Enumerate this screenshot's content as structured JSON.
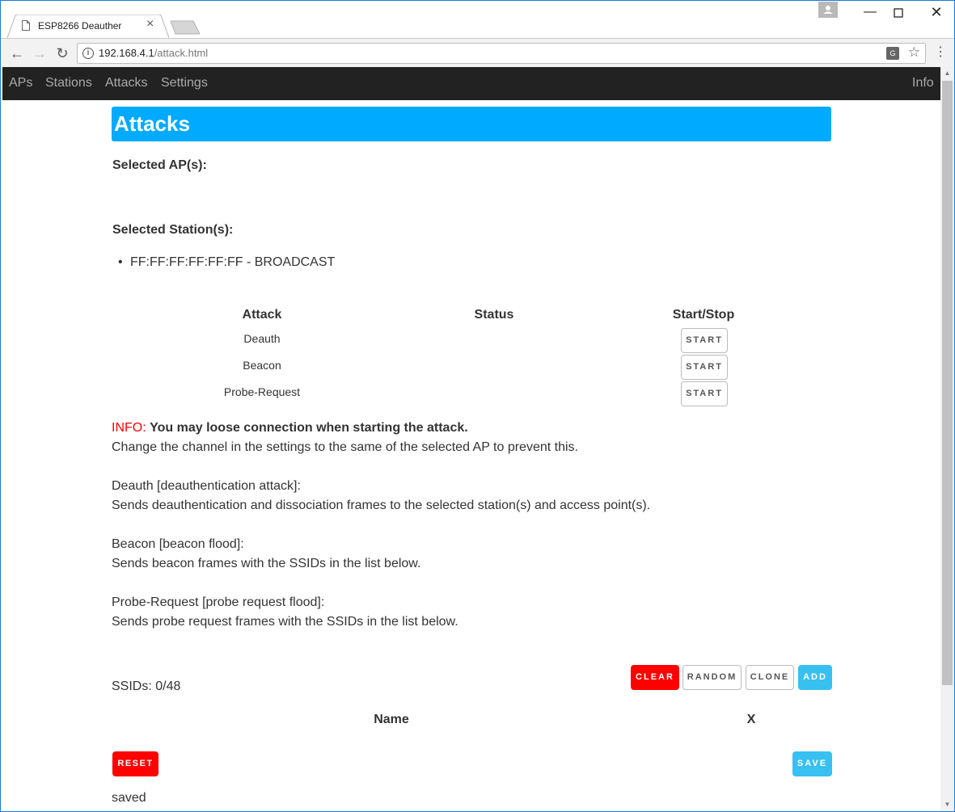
{
  "browser": {
    "tab_title": "ESP8266 Deauther",
    "url_host": "192.168.4.1",
    "url_path": "/attack.html"
  },
  "nav": {
    "items": [
      "APs",
      "Stations",
      "Attacks",
      "Settings"
    ],
    "right": "Info"
  },
  "page": {
    "title": "Attacks",
    "selected_aps_label": "Selected AP(s):",
    "selected_stations_label": "Selected Station(s):",
    "stations": [
      "FF:FF:FF:FF:FF:FF - BROADCAST"
    ],
    "attack_table": {
      "headers": [
        "Attack",
        "Status",
        "Start/Stop"
      ],
      "rows": [
        {
          "name": "Deauth",
          "status": "",
          "button": "START"
        },
        {
          "name": "Beacon",
          "status": "",
          "button": "START"
        },
        {
          "name": "Probe-Request",
          "status": "",
          "button": "START"
        }
      ]
    },
    "info": {
      "prefix": "INFO:",
      "bold": "You may loose connection when starting the attack.",
      "text": "Change the channel in the settings to the same of the selected AP to prevent this."
    },
    "descriptions": [
      {
        "title": "Deauth [deauthentication attack]:",
        "text": "Sends deauthentication and dissociation frames to the selected station(s) and access point(s)."
      },
      {
        "title": "Beacon [beacon flood]:",
        "text": "Sends beacon frames with the SSIDs in the list below."
      },
      {
        "title": "Probe-Request [probe request flood]:",
        "text": "Sends probe request frames with the SSIDs in the list below."
      }
    ],
    "ssids": {
      "count_label": "SSIDs: 0/48",
      "buttons": {
        "clear": "CLEAR",
        "random": "RANDOM",
        "clone": "CLONE",
        "add": "ADD"
      },
      "headers": {
        "name": "Name",
        "x": "X"
      },
      "reset": "RESET",
      "save": "SAVE",
      "status": "saved"
    }
  },
  "colors": {
    "accent": "#00aaff",
    "nav_bg": "#222222",
    "danger": "#ff0000",
    "info_button": "#38c0f0"
  }
}
